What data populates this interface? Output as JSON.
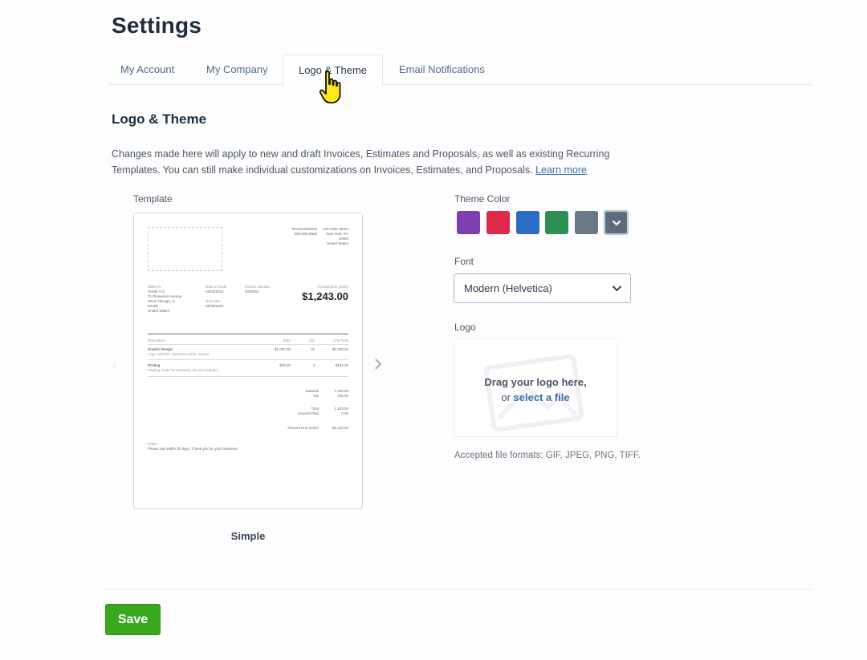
{
  "page": {
    "title": "Settings"
  },
  "tabs": [
    {
      "label": "My Account",
      "active": false
    },
    {
      "label": "My Company",
      "active": false
    },
    {
      "label": "Logo & Theme",
      "active": true
    },
    {
      "label": "Email Notifications",
      "active": false
    }
  ],
  "section": {
    "title": "Logo & Theme",
    "description": "Changes made here will apply to new and draft Invoices, Estimates and Proposals, as well as existing Recurring Templates. You can still make individual customizations on Invoices, Estimates, and Proposals.",
    "learn_more": "Learn more"
  },
  "template": {
    "label": "Template",
    "name": "Simple",
    "preview": {
      "invoice_number": "INV24-0000048",
      "phone": "555-555-5555",
      "address": [
        "123 Fake Street",
        "New York, NY",
        "10003",
        "United States"
      ],
      "billed_to_label": "Billed To",
      "billed_to": [
        "ACME CO.",
        "71 Pinewood Avenue",
        "West Chicago, IL",
        "60185",
        "United States"
      ],
      "date_label": "Date of Issue",
      "date": "02/05/2021",
      "due_label": "Due Date",
      "due": "06/05/2021",
      "number_label": "Invoice Number",
      "number": "0000001",
      "amount_label": "Amount Due (USD)",
      "amount": "$1,243.00",
      "col_description": "Description",
      "col_rate": "Rate",
      "col_qty": "Qty",
      "col_total": "Line Total",
      "items": [
        {
          "name": "Graphic Design",
          "detail": "Logo, website, business cards, menus",
          "rate": "$1,000.00",
          "qty": "10",
          "total": "$1,000.00"
        },
        {
          "name": "Printing",
          "detail": "Printing cards for business, ink not included",
          "rate": "$50.00",
          "qty": "4",
          "total": "$184.00"
        }
      ],
      "subtotal_label": "Subtotal",
      "subtotal": "1,190.00",
      "tax_label": "Tax",
      "tax": "105.00",
      "total_label": "Total",
      "total": "1,243.00",
      "paid_label": "Amount Paid",
      "paid": "0.00",
      "due_amount_label": "Amount Due (USD)",
      "due_amount": "$1,243.00",
      "notes_label": "Notes",
      "notes": "Please pay within 30 days. Thank you for your business!"
    }
  },
  "theme": {
    "label": "Theme Color",
    "colors": [
      "#7d3fb0",
      "#e02849",
      "#2b6cc4",
      "#2e8f55",
      "#6b7886"
    ],
    "selected_color": "#5d6b7a"
  },
  "font": {
    "label": "Font",
    "value": "Modern (Helvetica)"
  },
  "logo": {
    "label": "Logo",
    "drag_text": "Drag your logo here,",
    "or_text": "or",
    "select_link": "select a file",
    "formats": "Accepted file formats: GIF, JPEG, PNG, TIFF."
  },
  "actions": {
    "save_label": "Save"
  }
}
